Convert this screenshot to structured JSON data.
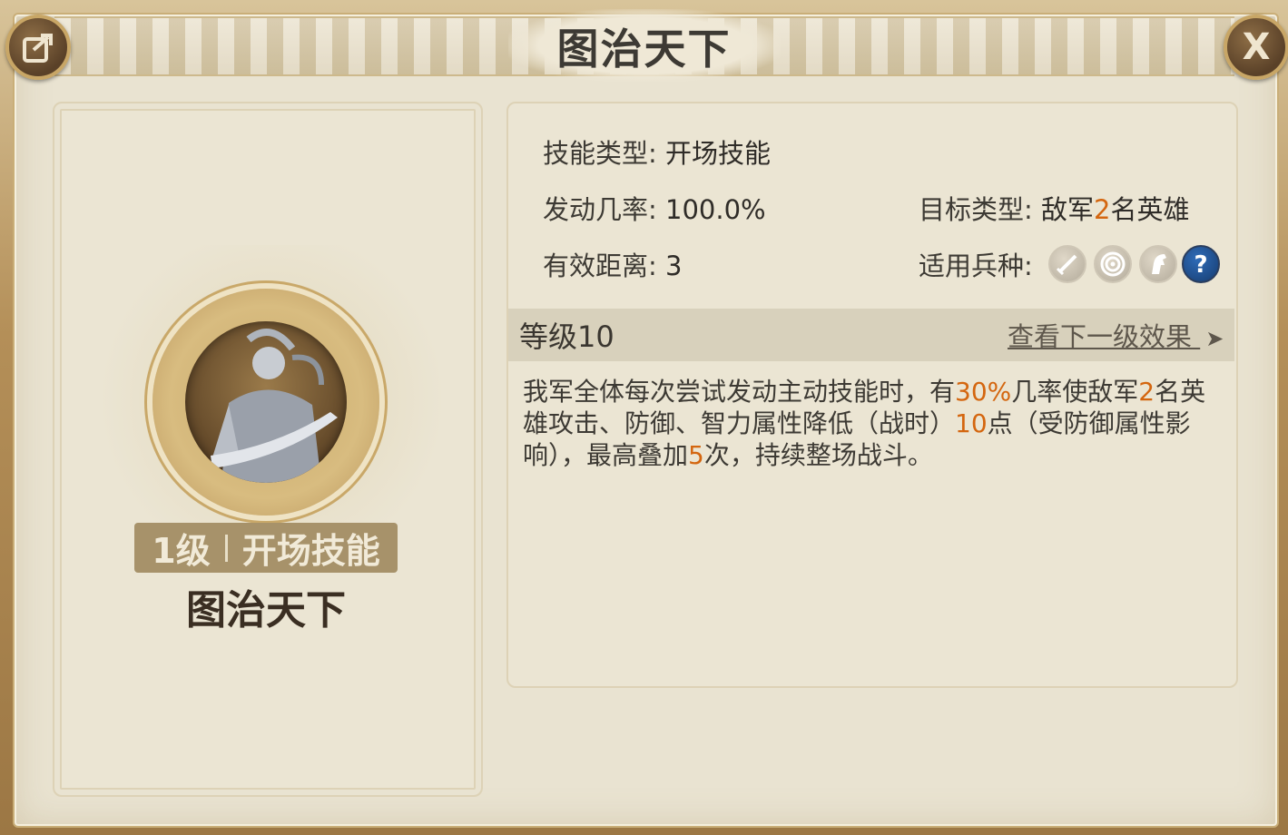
{
  "window": {
    "title": "图治天下"
  },
  "skill": {
    "level_label": "1级",
    "category_label": "开场技能",
    "name": "图治天下"
  },
  "info": {
    "skill_type_label": "技能类型:",
    "skill_type_value": "开场技能",
    "trigger_rate_label": "发动几率:",
    "trigger_rate_value": "100.0%",
    "target_type_label": "目标类型:",
    "target_type_prefix": "敌军",
    "target_type_count": "2",
    "target_type_suffix": "名英雄",
    "range_label": "有效距离:",
    "range_value": "3",
    "troop_types_label": "适用兵种:",
    "troop_types": [
      "sword-icon",
      "target-icon",
      "horse-icon",
      "question-icon"
    ]
  },
  "level": {
    "label": "等级10",
    "next_link": "查看下一级效果",
    "next_arrow": "➤"
  },
  "description": {
    "p1": "我军全体每次尝试发动主动技能时，有",
    "h1": "30%",
    "p2": "几率使敌军",
    "h2": "2",
    "p3": "名英雄攻击、防御、智力属性降低（战时）",
    "h3": "10",
    "p4": "点（受防御属性影响），最高叠加",
    "h4": "5",
    "p5": "次，持续整场战斗。"
  },
  "colors": {
    "accent_orange": "#d4660f",
    "panel_bg": "#e9e3d1",
    "level_bar": "#d8d1bc",
    "question_icon": "#1e4c8c"
  },
  "buttons": {
    "close_glyph": "X"
  }
}
